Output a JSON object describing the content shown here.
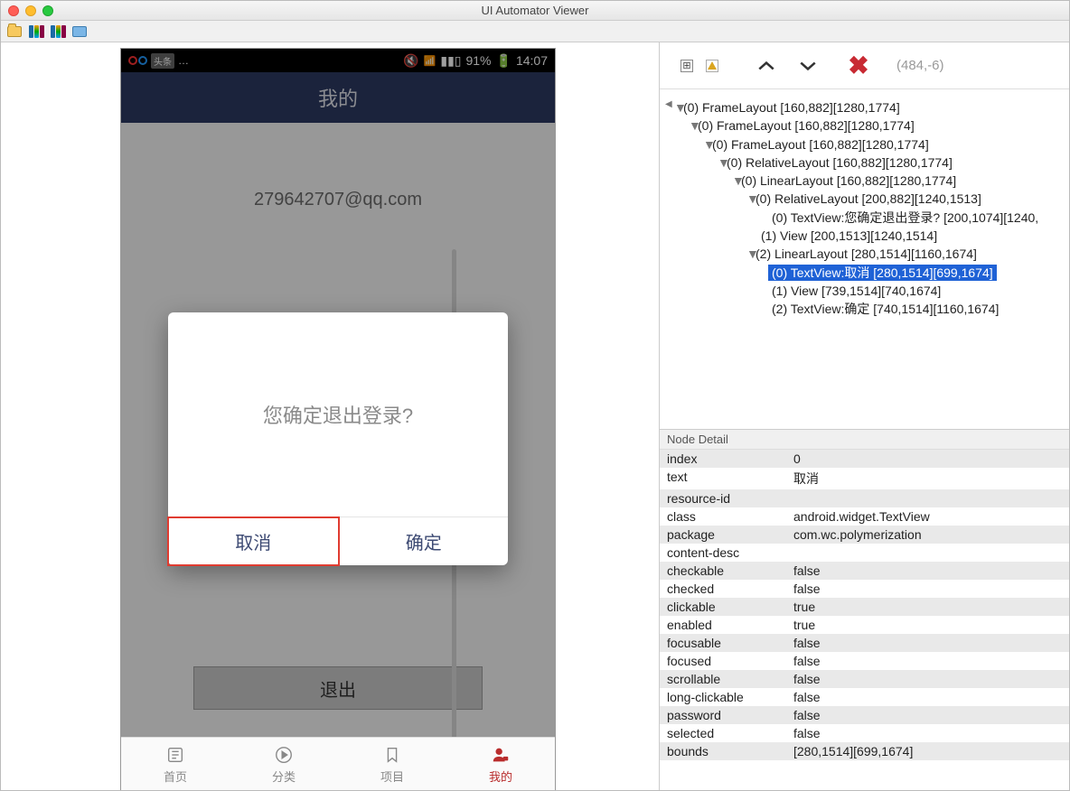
{
  "window_title": "UI Automator Viewer",
  "toolbar": {
    "open_label": "open",
    "devices_label": "devices",
    "devices2_label": "devices",
    "save_label": "save"
  },
  "phone": {
    "status": {
      "badge": "头条",
      "battery": "91%",
      "time": "14:07"
    },
    "header": "我的",
    "email": "279642707@qq.com",
    "logout": "退出",
    "dialog": {
      "message": "您确定退出登录?",
      "cancel": "取消",
      "confirm": "确定"
    },
    "nav": {
      "home": "首页",
      "category": "分类",
      "project": "项目",
      "mine": "我的"
    }
  },
  "tree_toolbar": {
    "coord": "(484,-6)"
  },
  "tree": [
    "(0) FrameLayout [160,882][1280,1774]",
    "(0) FrameLayout [160,882][1280,1774]",
    "(0) FrameLayout [160,882][1280,1774]",
    "(0) RelativeLayout [160,882][1280,1774]",
    "(0) LinearLayout [160,882][1280,1774]",
    "(0) RelativeLayout [200,882][1240,1513]",
    "(0) TextView:您确定退出登录? [200,1074][1240,",
    "(1) View [200,1513][1240,1514]",
    "(2) LinearLayout [280,1514][1160,1674]",
    "(0) TextView:取消 [280,1514][699,1674]",
    "(1) View [739,1514][740,1674]",
    "(2) TextView:确定 [740,1514][1160,1674]"
  ],
  "detail": {
    "title": "Node Detail",
    "rows": [
      [
        "index",
        "0"
      ],
      [
        "text",
        "取消"
      ],
      [
        "resource-id",
        ""
      ],
      [
        "class",
        "android.widget.TextView"
      ],
      [
        "package",
        "com.wc.polymerization"
      ],
      [
        "content-desc",
        ""
      ],
      [
        "checkable",
        "false"
      ],
      [
        "checked",
        "false"
      ],
      [
        "clickable",
        "true"
      ],
      [
        "enabled",
        "true"
      ],
      [
        "focusable",
        "false"
      ],
      [
        "focused",
        "false"
      ],
      [
        "scrollable",
        "false"
      ],
      [
        "long-clickable",
        "false"
      ],
      [
        "password",
        "false"
      ],
      [
        "selected",
        "false"
      ],
      [
        "bounds",
        "[280,1514][699,1674]"
      ]
    ]
  }
}
